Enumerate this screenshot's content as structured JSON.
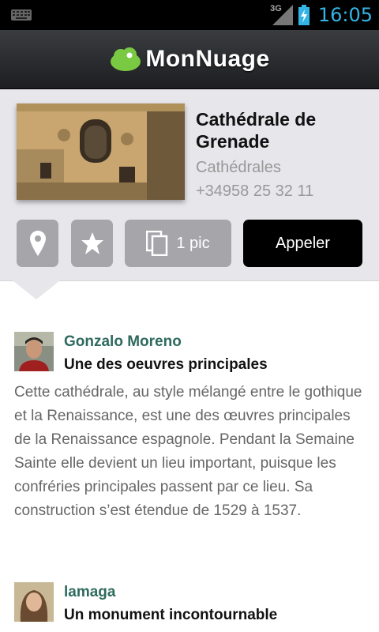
{
  "status_bar": {
    "network": "3G",
    "time": "16:05",
    "icons": [
      "keyboard-icon",
      "signal-icon",
      "battery-charging-icon"
    ]
  },
  "header": {
    "app_name": "MonNuage",
    "logo_icon": "cloud-logo-icon",
    "logo_color": "#7ac943"
  },
  "place": {
    "name": "Cathédrale de Grenade",
    "category": "Cathédrales",
    "phone": "+34958 25 32 11"
  },
  "actions": {
    "map_icon": "location-pin-icon",
    "favorite_icon": "star-icon",
    "pictures_icon": "copy-images-icon",
    "pictures_label": "1 pic",
    "call_label": "Appeler"
  },
  "reviews": [
    {
      "author": "Gonzalo Moreno",
      "title": "Une des oeuvres principales",
      "body": "Cette cathédrale, au style mélangé entre le gothique et la Renaissance, est une des œuvres principales de la Renaissance espagnole. Pendant la Semaine Sainte elle devient un lieu important, puisque les confréries principales passent par ce lieu. Sa construction s’est étendue de 1529 à 1537."
    },
    {
      "author": "lamaga",
      "title": "Un monument incontournable",
      "body": ""
    }
  ],
  "colors": {
    "accent": "#33b5e5",
    "author": "#2e6a5e",
    "button_gray": "#a6a6aa",
    "card_bg": "#e6e6eb"
  }
}
